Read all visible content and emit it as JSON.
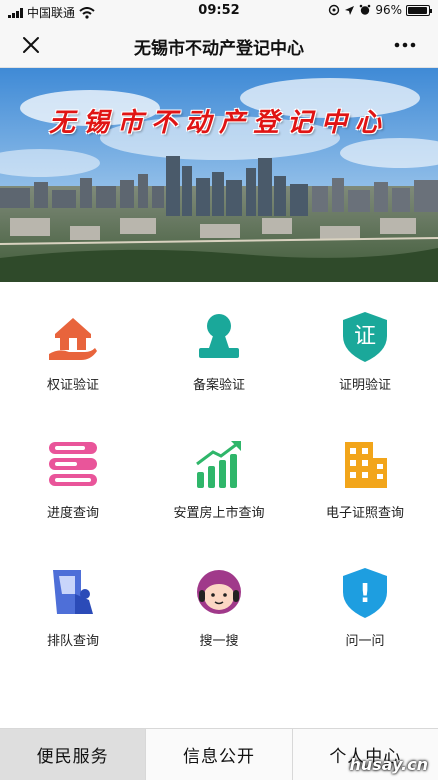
{
  "status_bar": {
    "carrier": "中国联通",
    "time": "09:52",
    "battery_text": "96%",
    "battery_level": 0.96
  },
  "nav": {
    "title": "无锡市不动产登记中心"
  },
  "banner": {
    "text": "无锡市不动产登记中心"
  },
  "grid": {
    "items": [
      {
        "label": "权证验证",
        "icon": "house-hand-icon",
        "color": "#e8643c"
      },
      {
        "label": "备案验证",
        "icon": "person-stamp-icon",
        "color": "#1aa89a"
      },
      {
        "label": "证明验证",
        "icon": "certificate-shield-icon",
        "color": "#1aa89a",
        "glyph": "证"
      },
      {
        "label": "进度查询",
        "icon": "progress-bars-icon",
        "color": "#e9559a"
      },
      {
        "label": "安置房上市查询",
        "icon": "growth-chart-icon",
        "color": "#2fb66a"
      },
      {
        "label": "电子证照查询",
        "icon": "building-icon",
        "color": "#f2a51a"
      },
      {
        "label": "排队查询",
        "icon": "queue-ticket-icon",
        "color": "#4e6fd8"
      },
      {
        "label": "搜一搜",
        "icon": "headset-agent-icon",
        "color": "#a0398a"
      },
      {
        "label": "问一问",
        "icon": "alert-shield-icon",
        "color": "#1e9ee0",
        "glyph": "!"
      }
    ]
  },
  "tabs": [
    {
      "label": "便民服务",
      "active": true
    },
    {
      "label": "信息公开",
      "active": false
    },
    {
      "label": "个人中心",
      "active": false
    }
  ],
  "watermark": "husay.cn"
}
